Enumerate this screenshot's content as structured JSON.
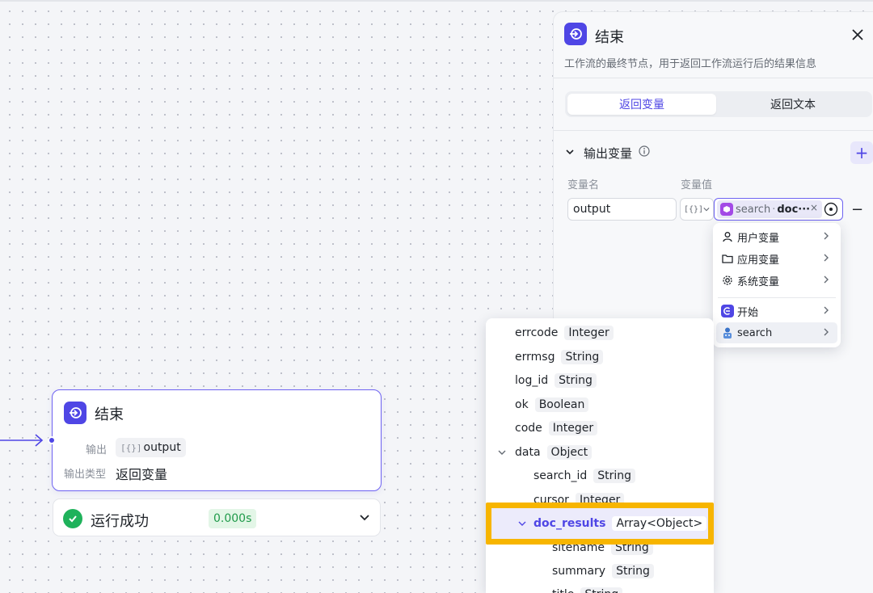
{
  "node": {
    "title": "结束",
    "output_label": "输出",
    "output_var_brackets": "[{}]",
    "output_var": "output",
    "type_label": "输出类型",
    "type_value": "返回变量"
  },
  "status": {
    "text": "运行成功",
    "time": "0.000s"
  },
  "panel": {
    "title": "结束",
    "description": "工作流的最终节点，用于返回工作流运行后的结果信息",
    "tabs": [
      {
        "label": "返回变量",
        "active": true
      },
      {
        "label": "返回文本",
        "active": false
      }
    ],
    "section_title": "输出变量",
    "add_label": "+",
    "col_name": "变量名",
    "col_value": "变量值",
    "row": {
      "name": "output",
      "type_brackets": "[{}]",
      "ref_source": "search",
      "ref_separator": "·",
      "ref_field": "doc···",
      "clear": "×",
      "remove": "−"
    }
  },
  "menu": {
    "items": [
      {
        "label": "用户变量",
        "icon": "user-icon"
      },
      {
        "label": "应用变量",
        "icon": "folder-icon"
      },
      {
        "label": "系统变量",
        "icon": "gear-icon"
      },
      {
        "label": "开始",
        "icon": "start-node-icon"
      },
      {
        "label": "search",
        "icon": "search-node-icon"
      }
    ]
  },
  "fields": [
    {
      "name": "errcode",
      "type": "Integer",
      "indent": 0
    },
    {
      "name": "errmsg",
      "type": "String",
      "indent": 0
    },
    {
      "name": "log_id",
      "type": "String",
      "indent": 0
    },
    {
      "name": "ok",
      "type": "Boolean",
      "indent": 0
    },
    {
      "name": "code",
      "type": "Integer",
      "indent": 0
    },
    {
      "name": "data",
      "type": "Object",
      "indent": 0,
      "expanded": true
    },
    {
      "name": "search_id",
      "type": "String",
      "indent": 1
    },
    {
      "name": "cursor",
      "type": "Integer",
      "indent": 1
    },
    {
      "name": "doc_results",
      "type": "Array<Object>",
      "indent": 1,
      "expanded": true,
      "selected": true
    },
    {
      "name": "sitename",
      "type": "String",
      "indent": 2
    },
    {
      "name": "summary",
      "type": "String",
      "indent": 2
    },
    {
      "name": "title",
      "type": "String",
      "indent": 2
    }
  ],
  "colors": {
    "accent": "#4f46e5",
    "success": "#1fb25b",
    "highlight": "#f7b500",
    "plugin": "#a34ae6"
  }
}
